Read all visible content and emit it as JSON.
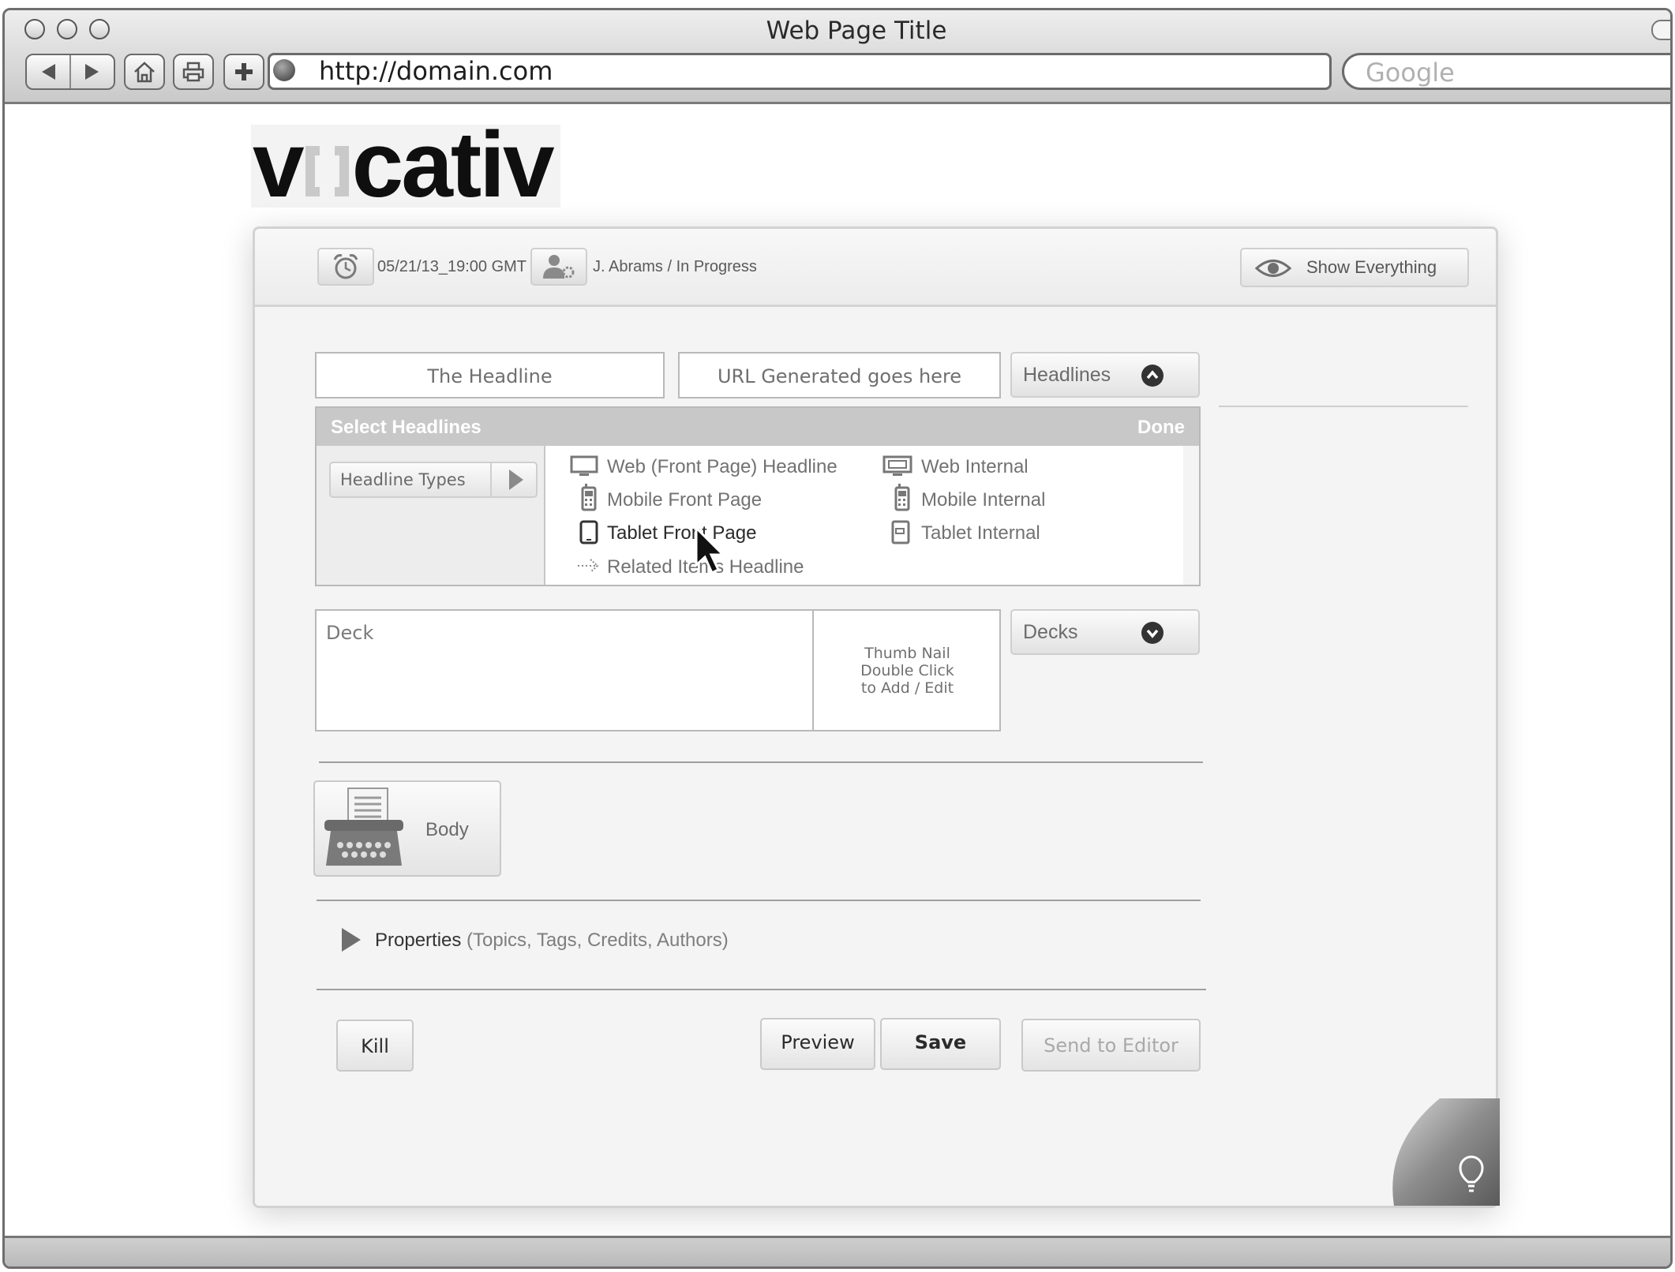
{
  "browser": {
    "window_title": "Web Page Title",
    "url": "http://domain.com",
    "search_placeholder": "Google"
  },
  "logo": {
    "brand": "vocativ",
    "left_text": "v",
    "right_text": "cativ"
  },
  "status_bar": {
    "timestamp": "05/21/13_19:00 GMT",
    "author_status": "J. Abrams / In Progress",
    "show_everything_label": "Show Everything"
  },
  "headline_section": {
    "headline_value": "The Headline",
    "url_value": "URL Generated goes here",
    "headlines_dropdown_label": "Headlines"
  },
  "select_headlines_panel": {
    "title": "Select Headlines",
    "done_label": "Done",
    "types_button_label": "Headline Types",
    "options": [
      {
        "label": "Web (Front Page) Headline",
        "icon": "monitor-icon"
      },
      {
        "label": "Mobile Front Page",
        "icon": "mobile-phone-icon"
      },
      {
        "label": "Tablet Front Page",
        "icon": "tablet-icon",
        "highlighted": true
      },
      {
        "label": "Related Items Headline",
        "icon": "dotted-arrow-icon"
      },
      {
        "label": "Web Internal",
        "icon": "monitor-internal-icon"
      },
      {
        "label": "Mobile Internal",
        "icon": "mobile-internal-icon"
      },
      {
        "label": "Tablet Internal",
        "icon": "tablet-internal-icon"
      }
    ]
  },
  "deck_section": {
    "deck_placeholder": "Deck",
    "thumbnail_line1": "Thumb Nail",
    "thumbnail_line2": "Double Click",
    "thumbnail_line3": "to Add / Edit",
    "decks_dropdown_label": "Decks"
  },
  "body_section": {
    "body_label": "Body"
  },
  "properties_section": {
    "label": "Properties",
    "detail": "(Topics, Tags, Credits, Authors)"
  },
  "actions": {
    "kill_label": "Kill",
    "preview_label": "Preview",
    "save_label": "Save",
    "send_label": "Send to Editor"
  },
  "colors": {
    "highlight": "#fbf68e",
    "panel_header": "#c8c8c8",
    "disabled_text": "#a9a9a9"
  }
}
